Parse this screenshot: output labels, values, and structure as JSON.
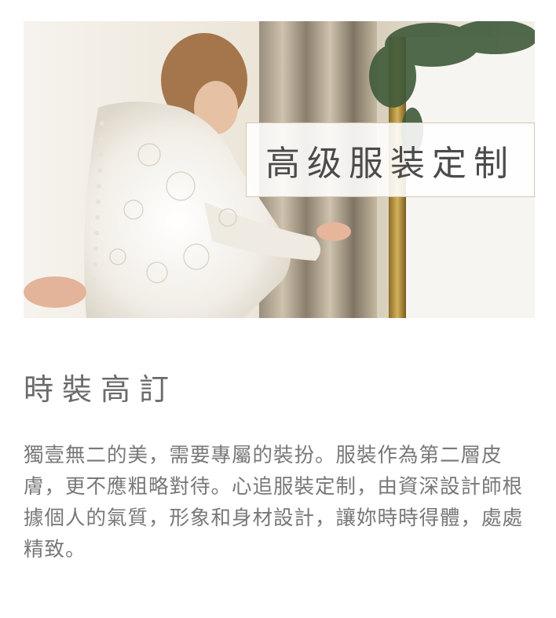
{
  "hero": {
    "image_alt": "bride in lace wedding dress",
    "title": "高级服装定制"
  },
  "section": {
    "title": "時裝高訂",
    "body": "獨壹無二的美，需要專屬的裝扮。服裝作為第二層皮膚，更不應粗略對待。心追服裝定制，由資深設計師根據個人的氣質，形象和身材設計，讓妳時時得體，處處精致。"
  },
  "colors": {
    "text": "#6b6b6b",
    "title_border": "#d8c7b1",
    "background": "#ffffff"
  }
}
